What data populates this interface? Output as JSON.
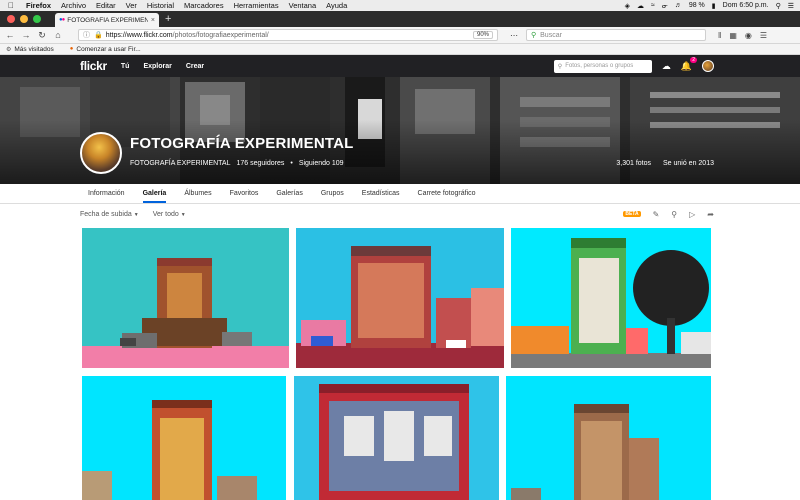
{
  "menubar": {
    "app": "Firefox",
    "items": [
      "Archivo",
      "Editar",
      "Ver",
      "Historial",
      "Marcadores",
      "Herramientas",
      "Ventana",
      "Ayuda"
    ],
    "battery": "98 %",
    "clock": "Dom 6:50 p.m."
  },
  "browser": {
    "tab_title": "FOTOGRAFÍA EXPERIMENTAL |",
    "url_host": "https://www.flickr.com",
    "url_path": "/photos/fotografiaexperimental/",
    "zoom": "90%",
    "search_placeholder": "Buscar",
    "bookmarks": [
      "Más visitados",
      "Comenzar a usar Fir..."
    ]
  },
  "flickr": {
    "logo": "flickr",
    "nav": [
      "Tú",
      "Explorar",
      "Crear"
    ],
    "search_placeholder": "Fotos, personas o grupos",
    "notification_count": "2"
  },
  "profile": {
    "title": "FOTOGRAFÍA EXPERIMENTAL",
    "name": "FOTOGRAFÍA EXPERIMENTAL",
    "followers": "176 seguidores",
    "separator": "•",
    "following": "Siguiendo 109",
    "photos": "3,301 fotos",
    "joined": "Se unió en 2013"
  },
  "subnav": {
    "tabs": [
      "Información",
      "Galería",
      "Álbumes",
      "Favoritos",
      "Galerías",
      "Grupos",
      "Estadísticas",
      "Carrete fotográfico"
    ],
    "active": "Galería"
  },
  "toolbar": {
    "sort": "Fecha de subida",
    "filter": "Ver todo",
    "beta": "BETA"
  },
  "colors": {
    "flickr_blue": "#0063dc",
    "flickr_pink": "#ff0084",
    "header_bg": "#212124"
  }
}
